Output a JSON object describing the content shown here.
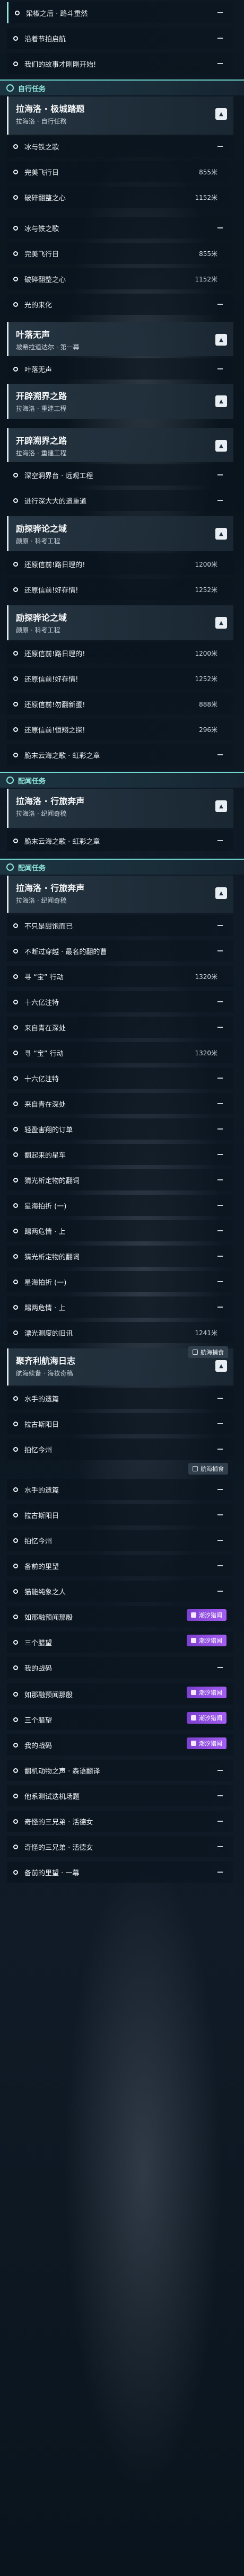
{
  "colors": {
    "accent": "#8fe6dd",
    "badge_purple": "#9b56ea"
  },
  "sections": {
    "s1": "自行任务",
    "s2": "配闻任务",
    "s3": "配闻任务"
  },
  "cards": {
    "c1": {
      "title": "拉海洛 · 极城踏题",
      "sub": "拉海洛 · 自行任務"
    },
    "c2": {
      "title": "叶落无声",
      "sub": "坡希拉道达尔 · 第一幕"
    },
    "c3": {
      "title": "开辟溯界之路",
      "sub": "拉海洛 · 重建工程"
    },
    "c4": {
      "title": "开辟溯界之路",
      "sub": "拉海洛 · 重建工程"
    },
    "c5": {
      "title": "励探骅论之域",
      "sub": "颜原 · 科考工程"
    },
    "c6": {
      "title": "励探骅论之域",
      "sub": "颜原 · 科考工程"
    },
    "c7": {
      "title": "拉海洛 · 行旅奔声",
      "sub": "拉海洛 · 纪闻奇稿"
    },
    "c8": {
      "title": "拉海洛 · 行旅奔声",
      "sub": "拉海洛 · 纪闻奇稿"
    },
    "c9": {
      "title": "聚齐利航海日志",
      "sub": "航海续备 · 海妆奇稿"
    }
  },
  "items": [
    "梁椒之后 · 路斗重然",
    "沿着节拍启航",
    "我们的故事才刚刚开始!",
    "冰与铁之歌",
    "完美飞行日",
    "破碎翻整之心",
    "冰与铁之歌",
    "完美飞行日",
    "破碎翻整之心",
    "光的来化",
    "叶落无声",
    "深空洞界台 · 远观工程",
    "进行深大大的遗重道",
    "还原信前!路日理的!",
    "还原信前!好存情!",
    "还原信前!路日理的!",
    "还原信前!好存情!",
    "还原信前!勿翻新蛋!",
    "还原信前!恒翔之探!",
    "脆末云海之歌 · 虹彩之章",
    "脆末云海之歌 · 虹彩之章",
    "不只是甜饱而已",
    "不断过穿越 · 最名的翻的曹",
    "寻 “宝” 行动",
    "十六亿注特",
    "来自青在深处",
    "寻 “宝” 行动",
    "十六亿注特",
    "来自青在深处",
    "轻盈害翔的订单",
    "翻起来的星车",
    "猜光析定物的翻词",
    "星海拍折 (一)",
    "踢两危情 · 上",
    "猜光析定物的翻词",
    "星海拍折 (一)",
    "踢两危情 · 上",
    "漂光测度的旧讯",
    "水手的遗篇",
    "拉古斯阳日",
    "拍忆今州",
    "水手的遗篇",
    "拉古斯阳日",
    "拍忆今州",
    "备前的里望",
    "猫能纯象之人",
    "如那融预闻那殷",
    "三个腊望",
    "我的战码",
    "如那融预闻那殷",
    "三个腊望",
    "我的战码",
    "翻机动物之声 · 森语翻译",
    "他系测试迭机场题",
    "奇怪的三兄弟 · 活德女",
    "奇怪的三兄弟 · 活德女",
    "备前的里望 · 一幕"
  ],
  "distances": {
    "d1": "855米",
    "d2": "1152米",
    "d3": "855米",
    "d4": "1152米",
    "d5": "1200米",
    "d6": "1252米",
    "d7": "1200米",
    "d8": "1252米",
    "d9": "888米",
    "d10": "296米",
    "d11": "1320米",
    "d12": "1320米",
    "d13": "1241米"
  },
  "badges": {
    "b1": "航海捕食",
    "b2": "航海捕食",
    "b3": "潮汐猎闻",
    "b4": "潮汐猎闻",
    "b5": "潮汐猎闻",
    "b6": "潮汐猎闻",
    "b7": "潮汐猎闻",
    "b8": "潮汐猎闻"
  }
}
